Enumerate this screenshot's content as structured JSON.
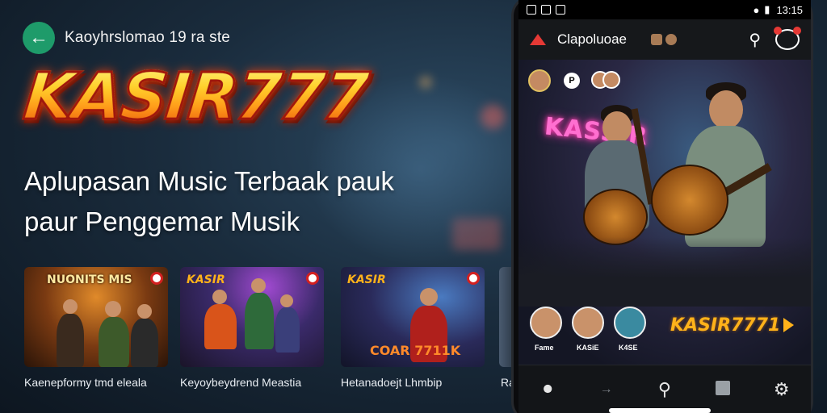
{
  "header": {
    "back_icon": "arrow-left-icon",
    "title": "Kaoyhrslomao 19 ra ste"
  },
  "hero": {
    "logo": "KASIR777",
    "tagline_line1": "Aplupasan Music Terbaak pauk",
    "tagline_line2": "paur Penggemar Musik"
  },
  "cards": [
    {
      "art_title": "NUONITS MIS",
      "label": "Kaenepformy tmd eleala"
    },
    {
      "art_title": "KASIR",
      "label": "Keyoybeydrend Meastia"
    },
    {
      "art_title": "KASIR",
      "art_subtitle": "COAR 7711K",
      "label": "Hetanadoejt Lhmbip"
    },
    {
      "label": "Ra"
    }
  ],
  "phone": {
    "status_time": "13:15",
    "app_title": "Clapoluoae",
    "search_icon": "search-icon",
    "profile_icon": "profile-icon",
    "hero_neon": "KASSIR",
    "hero_brand": "KASIR7771",
    "hero_small_badge": "P",
    "mini_avatars": [
      {
        "label": "Fame"
      },
      {
        "label": "KASiE"
      },
      {
        "label": "K4SE"
      }
    ],
    "bottom_nav": [
      {
        "icon": "home-icon"
      },
      {
        "icon": "arrow-right-icon"
      },
      {
        "icon": "search-icon"
      },
      {
        "icon": "stop-icon"
      },
      {
        "icon": "settings-icon"
      }
    ]
  },
  "colors": {
    "accent_green": "#1e9b6a",
    "logo_gold": "#ffcc2a",
    "brand_orange": "#ffb21a",
    "badge_red": "#e53935"
  }
}
